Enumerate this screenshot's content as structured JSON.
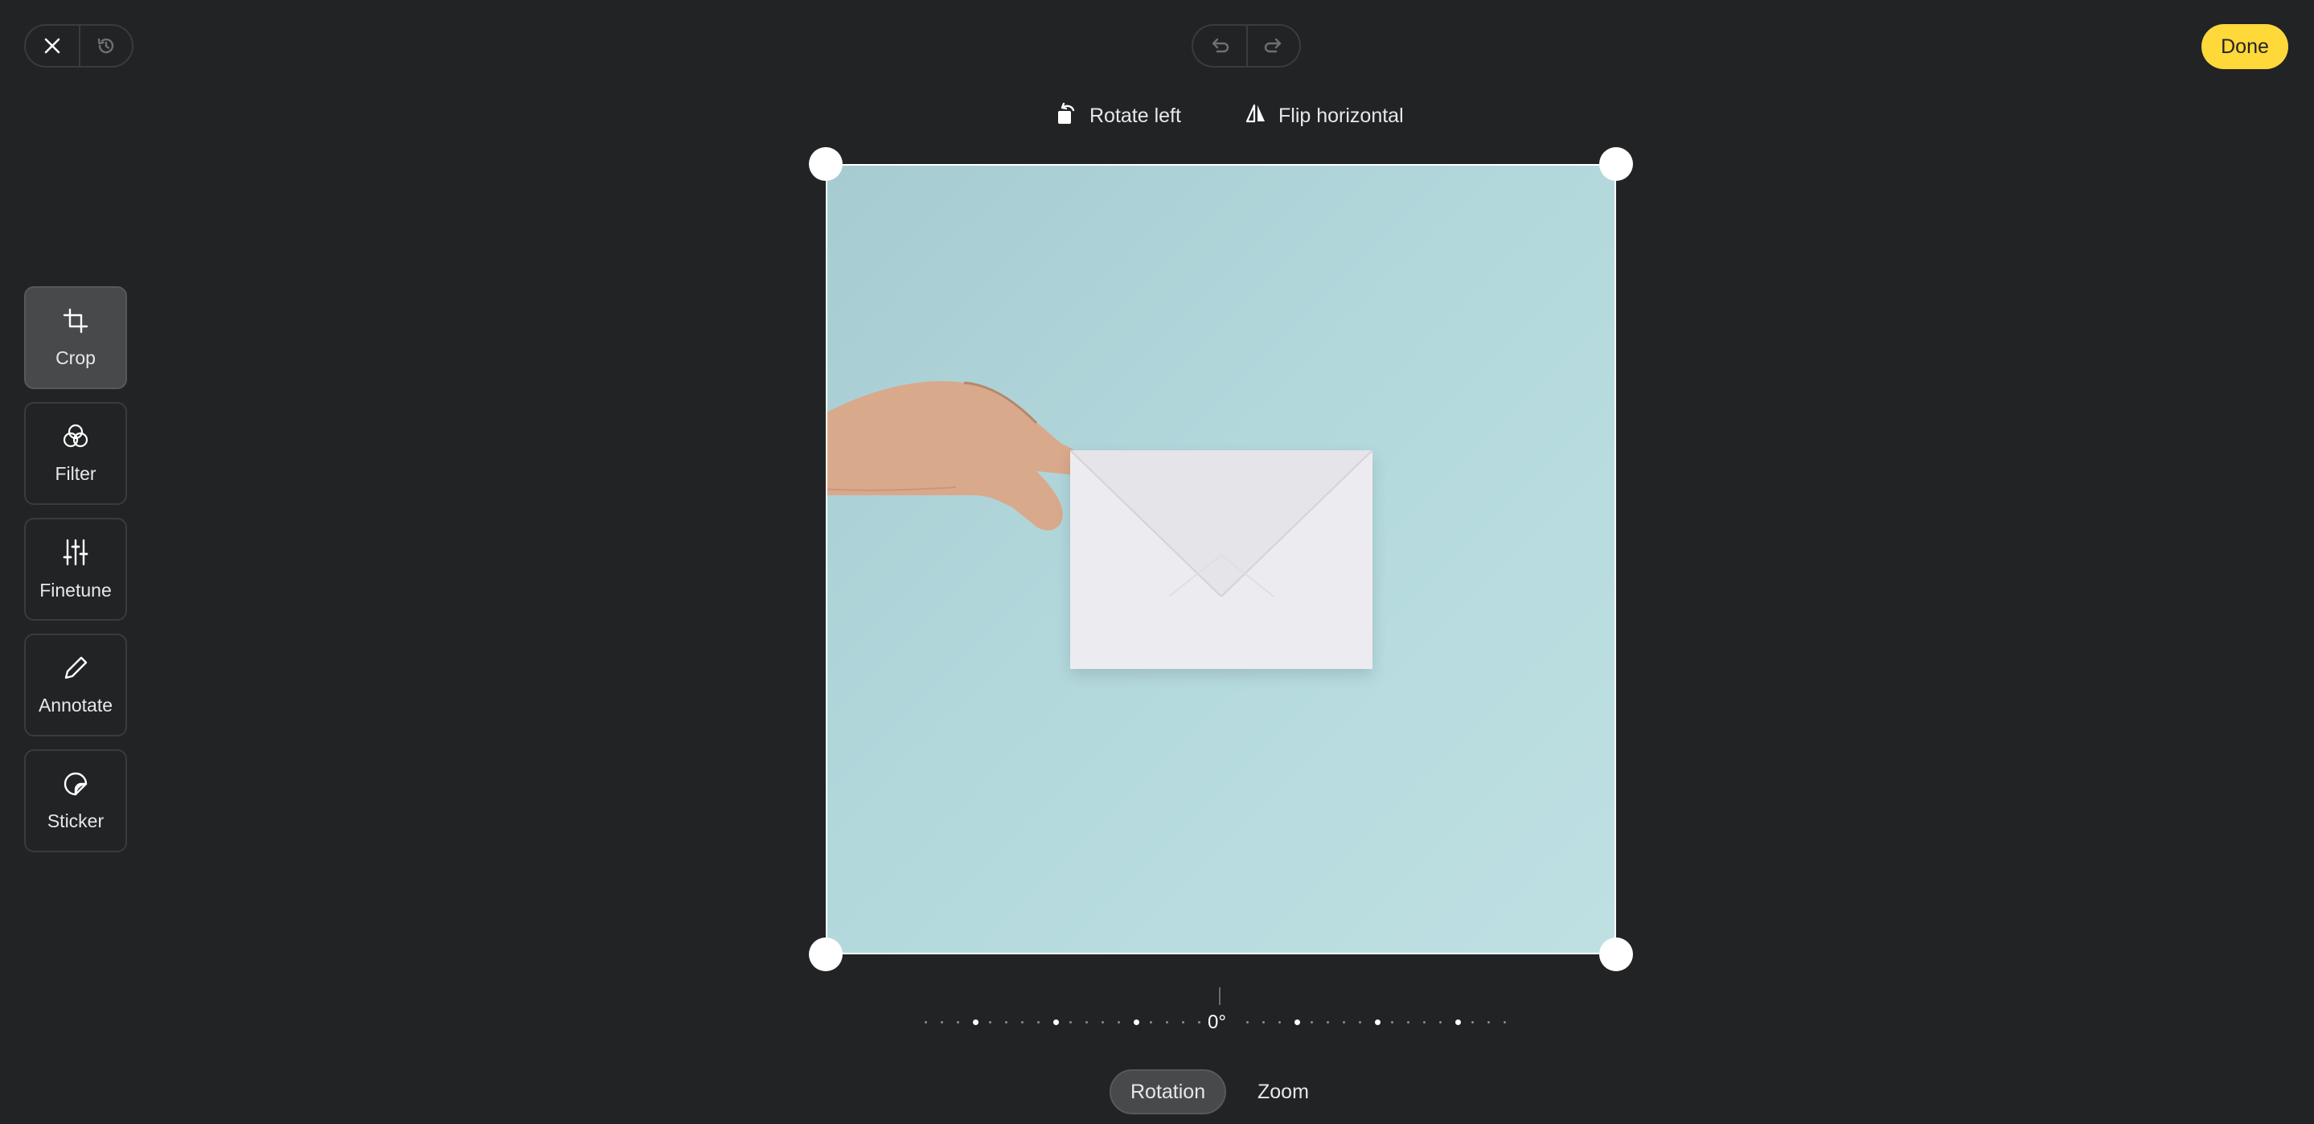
{
  "header": {
    "close_icon": "close-icon",
    "history_icon": "history-icon",
    "undo_icon": "undo-icon",
    "redo_icon": "redo-icon",
    "done_label": "Done"
  },
  "toolbar": {
    "rotate_left_label": "Rotate left",
    "flip_horizontal_label": "Flip horizontal"
  },
  "sidebar": {
    "items": [
      {
        "label": "Crop",
        "icon": "crop-icon",
        "active": true
      },
      {
        "label": "Filter",
        "icon": "filter-icon",
        "active": false
      },
      {
        "label": "Finetune",
        "icon": "finetune-icon",
        "active": false
      },
      {
        "label": "Annotate",
        "icon": "pencil-icon",
        "active": false
      },
      {
        "label": "Sticker",
        "icon": "sticker-icon",
        "active": false
      }
    ]
  },
  "rotation": {
    "value_label": "0°"
  },
  "tabs": [
    {
      "label": "Rotation",
      "active": true
    },
    {
      "label": "Zoom",
      "active": false
    }
  ],
  "colors": {
    "background": "#222325",
    "accent": "#ffd83a"
  }
}
